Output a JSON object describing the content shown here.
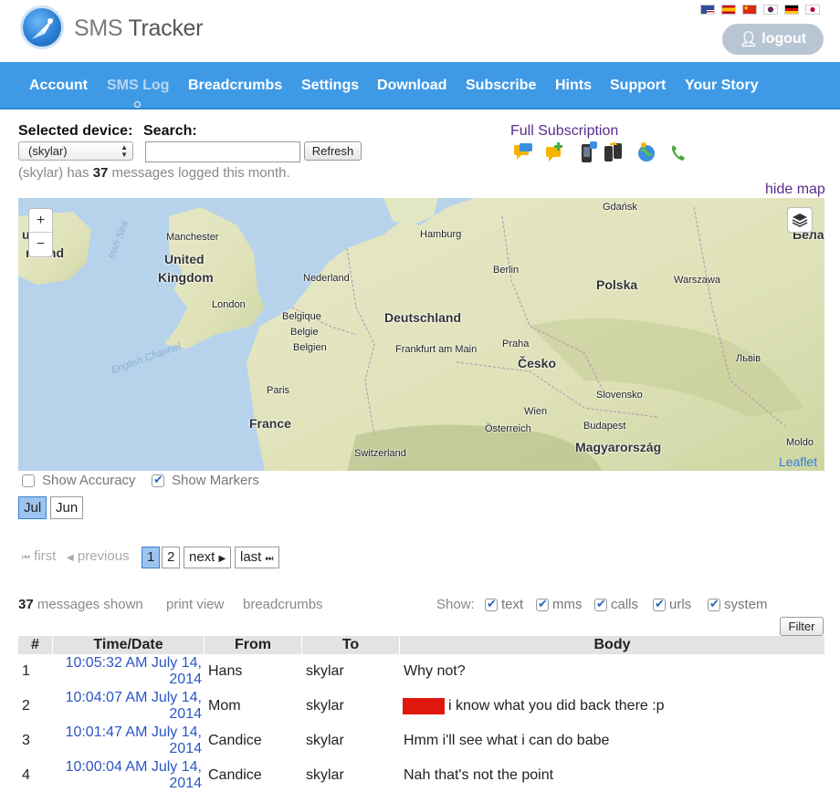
{
  "app": {
    "logo_light": "SMS",
    "logo_bold": "Tracker",
    "logout_label": "logout",
    "flags": [
      "us",
      "es",
      "cn",
      "kr",
      "de",
      "jp"
    ]
  },
  "nav": {
    "items": [
      "Account",
      "SMS Log",
      "Breadcrumbs",
      "Settings",
      "Download",
      "Subscribe",
      "Hints",
      "Support",
      "Your Story"
    ],
    "active": "SMS Log"
  },
  "controls": {
    "device_label": "Selected device:",
    "device_value": "(skylar)",
    "search_label": "Search:",
    "search_value": "",
    "refresh_label": "Refresh",
    "message_prefix": "(skylar) has",
    "message_count": "37",
    "message_suffix": "messages logged this month.",
    "full_subscription": "Full Subscription",
    "hide_map": "hide map",
    "subscription_icons": [
      "sms-icon",
      "mms-icon",
      "phone-icon",
      "phone-transfer-icon",
      "globe-icon",
      "call-icon"
    ]
  },
  "map": {
    "labels": [
      "ublic",
      "reland",
      "Manchester",
      "United",
      "Kingdom",
      "London",
      "Nederland",
      "Hamburg",
      "Berlin",
      "Gdańsk",
      "Polska",
      "Warszawa",
      "Беларус",
      "Belgique",
      "Belgie",
      "Belgien",
      "Deutschland",
      "Frankfurt am Main",
      "Praha",
      "Česko",
      "Львів",
      "Paris",
      "France",
      "Wien",
      "Slovensko",
      "Österreich",
      "Budapest",
      "Magyarország",
      "Switzerland",
      "Moldo",
      "Irish Sea",
      "English Channel"
    ],
    "attribution": "Leaflet",
    "zoom_in": "+",
    "zoom_out": "−"
  },
  "map_options": {
    "show_accuracy": "Show Accuracy",
    "show_accuracy_checked": false,
    "show_markers": "Show Markers",
    "show_markers_checked": true
  },
  "months": {
    "items": [
      "Jul",
      "Jun"
    ],
    "active": "Jul"
  },
  "pager": {
    "first": "first",
    "previous": "previous",
    "pages": [
      "1",
      "2"
    ],
    "current": "1",
    "next": "next",
    "last": "last"
  },
  "summary": {
    "count": "37",
    "count_suffix": "messages shown",
    "print_view": "print view",
    "breadcrumbs": "breadcrumbs",
    "show_label": "Show:",
    "filters": [
      {
        "label": "text",
        "checked": true
      },
      {
        "label": "mms",
        "checked": true
      },
      {
        "label": "calls",
        "checked": true
      },
      {
        "label": "urls",
        "checked": true
      },
      {
        "label": "system",
        "checked": true
      }
    ],
    "filter_button": "Filter"
  },
  "table": {
    "headers": [
      "#",
      "Time/Date",
      "From",
      "To",
      "Body"
    ],
    "rows": [
      {
        "num": "1",
        "time": "10:05:32 AM July 14,",
        "year": "2014",
        "from": "Hans",
        "to": "skylar",
        "body": "Why not?",
        "redacted": false
      },
      {
        "num": "2",
        "time": "10:04:07 AM July 14,",
        "year": "2014",
        "from": "Mom",
        "to": "skylar",
        "body": "i know what you did back there :p",
        "redacted": true
      },
      {
        "num": "3",
        "time": "10:01:47 AM July 14,",
        "year": "2014",
        "from": "Candice",
        "to": "skylar",
        "body": "Hmm i'll see what i can do babe",
        "redacted": false
      },
      {
        "num": "4",
        "time": "10:00:04 AM July 14,",
        "year": "2014",
        "from": "Candice",
        "to": "skylar",
        "body": "Nah that's not the point",
        "redacted": false
      }
    ]
  }
}
